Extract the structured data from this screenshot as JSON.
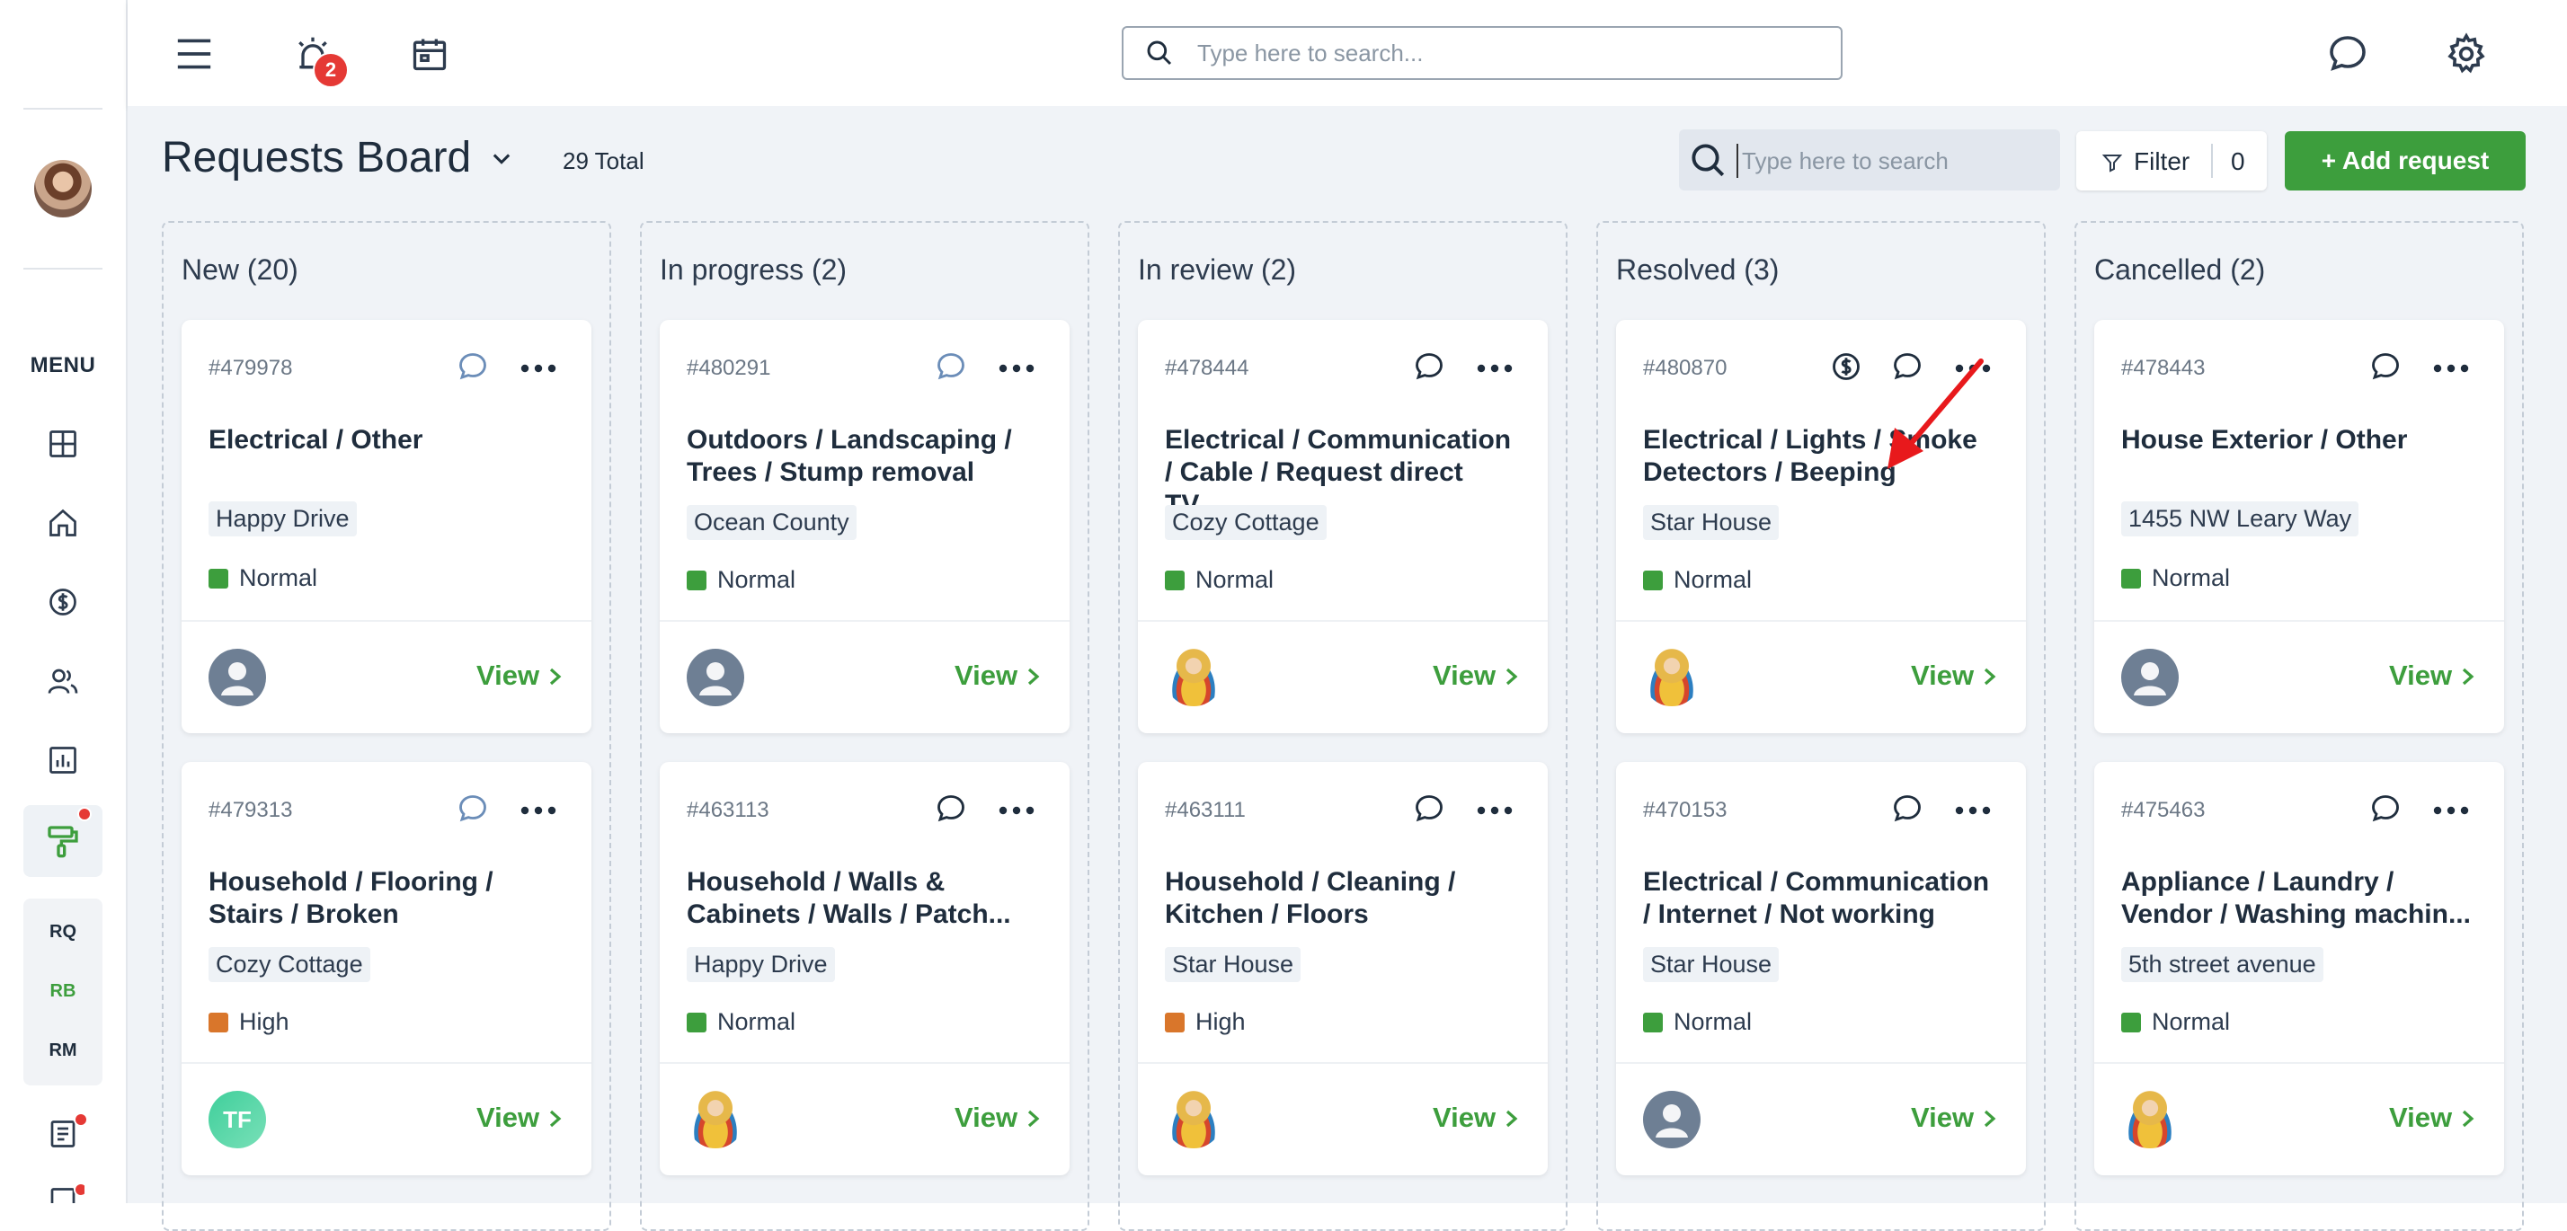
{
  "topbar": {
    "notification_count": "2",
    "search_placeholder": "Type here to search..."
  },
  "sidebar": {
    "menu_label": "MENU",
    "sub_items": [
      "RQ",
      "RB",
      "RM"
    ]
  },
  "board": {
    "title": "Requests Board",
    "total": "29 Total",
    "search_placeholder": "Type here to search",
    "filter_label": "Filter",
    "filter_count": "0",
    "add_label": "+ Add request",
    "view_label": "View",
    "columns": [
      {
        "title": "New (20)",
        "cards": [
          {
            "id": "#479978",
            "title": "Electrical / Other",
            "location": "Happy Drive",
            "priority": "Normal"
          },
          {
            "id": "#479313",
            "title": "Household / Flooring / Stairs / Broken",
            "location": "Cozy Cottage",
            "priority": "High",
            "avatar_initials": "TF"
          }
        ]
      },
      {
        "title": "In progress (2)",
        "cards": [
          {
            "id": "#480291",
            "title": "Outdoors / Landscaping / Trees / Stump removal",
            "location": "Ocean County",
            "priority": "Normal"
          },
          {
            "id": "#463113",
            "title": "Household / Walls & Cabinets / Walls / Patch...",
            "location": "Happy Drive",
            "priority": "Normal"
          }
        ]
      },
      {
        "title": "In review (2)",
        "cards": [
          {
            "id": "#478444",
            "title": "Electrical / Communication / Cable / Request direct TV...",
            "location": "Cozy Cottage",
            "priority": "Normal"
          },
          {
            "id": "#463111",
            "title": "Household / Cleaning / Kitchen / Floors",
            "location": "Star House",
            "priority": "High"
          }
        ]
      },
      {
        "title": "Resolved (3)",
        "cards": [
          {
            "id": "#480870",
            "title": "Electrical / Lights / Smoke Detectors / Beeping",
            "location": "Star House",
            "priority": "Normal"
          },
          {
            "id": "#470153",
            "title": "Electrical / Communication / Internet / Not working",
            "location": "Star House",
            "priority": "Normal"
          }
        ]
      },
      {
        "title": "Cancelled (2)",
        "cards": [
          {
            "id": "#478443",
            "title": "House Exterior / Other",
            "location": "1455 NW Leary Way",
            "priority": "Normal"
          },
          {
            "id": "#475463",
            "title": "Appliance / Laundry / Vendor / Washing machin...",
            "location": "5th street avenue",
            "priority": "Normal"
          }
        ]
      }
    ]
  },
  "colors": {
    "accent_green": "#3d9e3d",
    "priority_normal": "#3d9e3d",
    "priority_high": "#d9762b",
    "badge_red": "#e53935",
    "annotation_arrow": "#e8191c"
  }
}
